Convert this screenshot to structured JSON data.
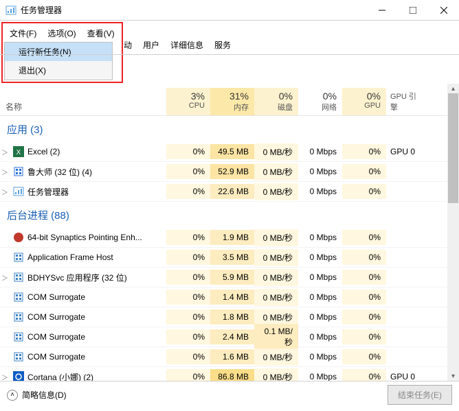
{
  "window": {
    "title": "任务管理器"
  },
  "menubar": {
    "items": [
      {
        "label": "文件(F)"
      },
      {
        "label": "选项(O)"
      },
      {
        "label": "查看(V)"
      }
    ],
    "dropdown": [
      {
        "label": "运行新任务(N)",
        "selected": true
      },
      {
        "label": "退出(X)",
        "selected": false
      }
    ]
  },
  "tabs": [
    {
      "label": "动"
    },
    {
      "label": "用户"
    },
    {
      "label": "详细信息"
    },
    {
      "label": "服务"
    }
  ],
  "columns": {
    "name": "名称",
    "cols": [
      {
        "pct": "3%",
        "label": "CPU",
        "hl": "hl"
      },
      {
        "pct": "31%",
        "label": "内存",
        "hl": "hl2"
      },
      {
        "pct": "0%",
        "label": "磁盘",
        "hl": "hl"
      },
      {
        "pct": "0%",
        "label": "网络",
        "hl": ""
      },
      {
        "pct": "0%",
        "label": "GPU",
        "hl": "hl"
      }
    ],
    "gpueng": "GPU 引擎"
  },
  "groups": [
    {
      "title": "应用 (3)",
      "rows": [
        {
          "icon": "excel",
          "name": "Excel (2)",
          "exp": true,
          "cpu": "0%",
          "mem": "49.5 MB",
          "disk": "0 MB/秒",
          "net": "0 Mbps",
          "gpu": "0%",
          "gpueng": "GPU 0"
        },
        {
          "icon": "ludashi",
          "name": "鲁大师 (32 位) (4)",
          "exp": true,
          "cpu": "0%",
          "mem": "52.9 MB",
          "disk": "0 MB/秒",
          "net": "0 Mbps",
          "gpu": "0%",
          "gpueng": ""
        },
        {
          "icon": "taskmgr",
          "name": "任务管理器",
          "exp": true,
          "cpu": "0%",
          "mem": "22.6 MB",
          "disk": "0 MB/秒",
          "net": "0 Mbps",
          "gpu": "0%",
          "gpueng": ""
        }
      ]
    },
    {
      "title": "后台进程 (88)",
      "rows": [
        {
          "icon": "syn",
          "name": "64-bit Synaptics Pointing Enh...",
          "exp": false,
          "cpu": "0%",
          "mem": "1.9 MB",
          "disk": "0 MB/秒",
          "net": "0 Mbps",
          "gpu": "0%",
          "gpueng": ""
        },
        {
          "icon": "app",
          "name": "Application Frame Host",
          "exp": false,
          "cpu": "0%",
          "mem": "3.5 MB",
          "disk": "0 MB/秒",
          "net": "0 Mbps",
          "gpu": "0%",
          "gpueng": ""
        },
        {
          "icon": "bdhy",
          "name": "BDHYSvc 应用程序 (32 位)",
          "exp": true,
          "cpu": "0%",
          "mem": "5.9 MB",
          "disk": "0 MB/秒",
          "net": "0 Mbps",
          "gpu": "0%",
          "gpueng": ""
        },
        {
          "icon": "com",
          "name": "COM Surrogate",
          "exp": false,
          "cpu": "0%",
          "mem": "1.4 MB",
          "disk": "0 MB/秒",
          "net": "0 Mbps",
          "gpu": "0%",
          "gpueng": ""
        },
        {
          "icon": "com",
          "name": "COM Surrogate",
          "exp": false,
          "cpu": "0%",
          "mem": "1.8 MB",
          "disk": "0 MB/秒",
          "net": "0 Mbps",
          "gpu": "0%",
          "gpueng": ""
        },
        {
          "icon": "com",
          "name": "COM Surrogate",
          "exp": false,
          "cpu": "0%",
          "mem": "2.4 MB",
          "disk": "0.1 MB/秒",
          "net": "0 Mbps",
          "gpu": "0%",
          "gpueng": ""
        },
        {
          "icon": "com",
          "name": "COM Surrogate",
          "exp": false,
          "cpu": "0%",
          "mem": "1.6 MB",
          "disk": "0 MB/秒",
          "net": "0 Mbps",
          "gpu": "0%",
          "gpueng": ""
        },
        {
          "icon": "cortana",
          "name": "Cortana (小娜) (2)",
          "exp": true,
          "cpu": "0%",
          "mem": "86.8 MB",
          "disk": "0 MB/秒",
          "net": "0 Mbps",
          "gpu": "0%",
          "gpueng": "GPU 0"
        }
      ]
    }
  ],
  "footer": {
    "less": "简略信息(D)",
    "end": "结束任务(E)"
  },
  "icons": {
    "excel": "#217346",
    "ludashi": "#2a6fd6",
    "taskmgr": "#5aa1e0",
    "syn": "#c0392b",
    "app": "#3b82c4",
    "bdhy": "#3b82c4",
    "com": "#3b82c4",
    "cortana": "#0a5bc4"
  },
  "heat": {
    "cpu": [
      "c0",
      "c0",
      "c0",
      "c0",
      "c0",
      "c0",
      "c0",
      "c0",
      "c0",
      "c0",
      "c0"
    ],
    "mem": [
      "c2",
      "c2",
      "c1",
      "c1",
      "c1",
      "c1",
      "c1",
      "c1",
      "c1",
      "c1",
      "c3"
    ],
    "disk": [
      "c0",
      "c0",
      "c0",
      "c0",
      "c0",
      "c0",
      "c0",
      "c0",
      "c1",
      "c0",
      "c0"
    ],
    "net": [
      "",
      "",
      "",
      "",
      "",
      "",
      "",
      "",
      "",
      "",
      ""
    ],
    "gpu": [
      "c0",
      "c0",
      "c0",
      "c0",
      "c0",
      "c0",
      "c0",
      "c0",
      "c0",
      "c0",
      "c0"
    ]
  }
}
